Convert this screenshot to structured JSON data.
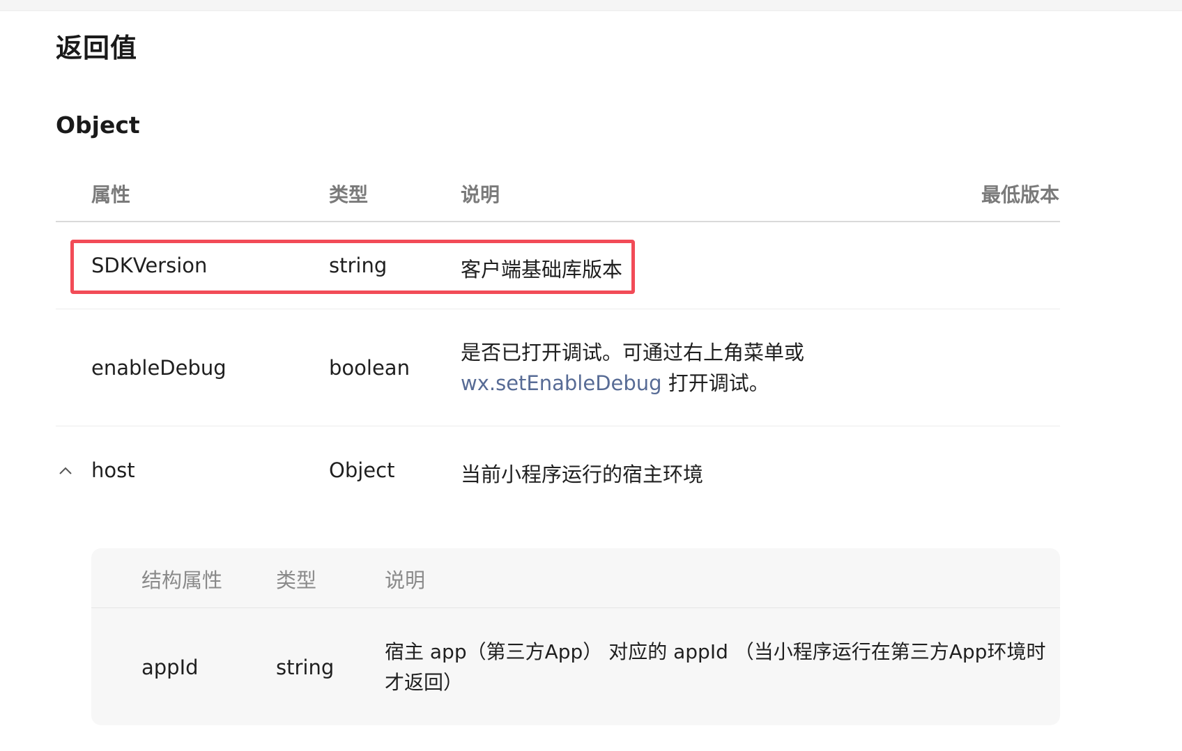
{
  "section_title": "返回值",
  "object_title": "Object",
  "table": {
    "headers": {
      "property": "属性",
      "type": "类型",
      "description": "说明",
      "min_version": "最低版本"
    },
    "rows": [
      {
        "property": "SDKVersion",
        "type": "string",
        "description": "客户端基础库版本"
      },
      {
        "property": "enableDebug",
        "type": "boolean",
        "description_line1": "是否已打开调试。可通过右上角菜单或",
        "description_link": "wx.setEnableDebug",
        "description_line2_rest": " 打开调试。"
      },
      {
        "property": "host",
        "type": "Object",
        "description": "当前小程序运行的宿主环境",
        "expand_icon": "chevron-up-icon"
      }
    ]
  },
  "sub_table": {
    "headers": {
      "property": "结构属性",
      "type": "类型",
      "description": "说明"
    },
    "rows": [
      {
        "property": "appId",
        "type": "string",
        "description_line1": "宿主 app（第三方App） 对应的 appId （当小程序运行在第三方App环境时",
        "description_line2": "才返回）"
      }
    ]
  },
  "colors": {
    "highlight": "#f24b57",
    "link": "#576b95",
    "header_text": "#7a7a7a",
    "sub_table_bg": "#f7f7f7"
  }
}
